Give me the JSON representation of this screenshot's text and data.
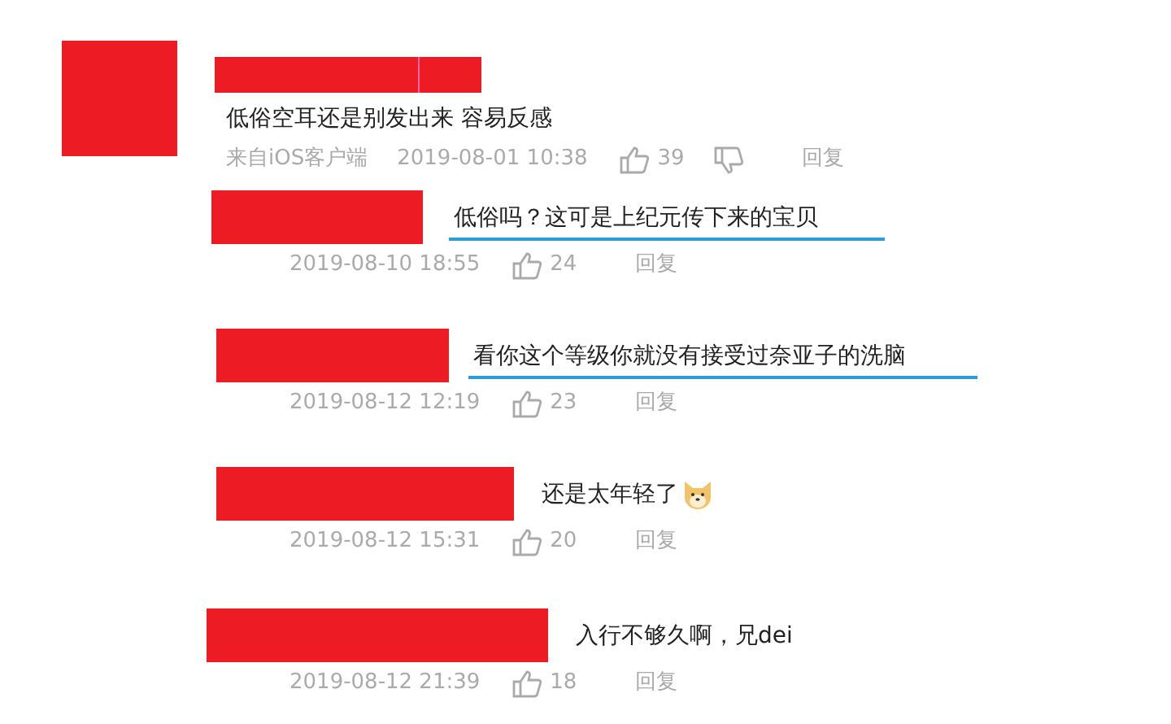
{
  "comment": {
    "text": "低俗空耳还是别发出来 容易反感",
    "source": "来自iOS客户端",
    "time": "2019-08-01 10:38",
    "likes": "39",
    "reply": "回复"
  },
  "replies": [
    {
      "text": "低俗吗？这可是上纪元传下来的宝贝",
      "underlined": true,
      "emoji": false,
      "time": "2019-08-10 18:55",
      "likes": "24",
      "reply": "回复"
    },
    {
      "text": "看你这个等级你就没有接受过奈亚子的洗脑",
      "underlined": true,
      "emoji": false,
      "time": "2019-08-12 12:19",
      "likes": "23",
      "reply": "回复"
    },
    {
      "text": "还是太年轻了",
      "underlined": false,
      "emoji": true,
      "time": "2019-08-12 15:31",
      "likes": "20",
      "reply": "回复"
    },
    {
      "text": "入行不够久啊，兄dei",
      "underlined": false,
      "emoji": false,
      "time": "2019-08-12 21:39",
      "likes": "18",
      "reply": "回复"
    }
  ]
}
